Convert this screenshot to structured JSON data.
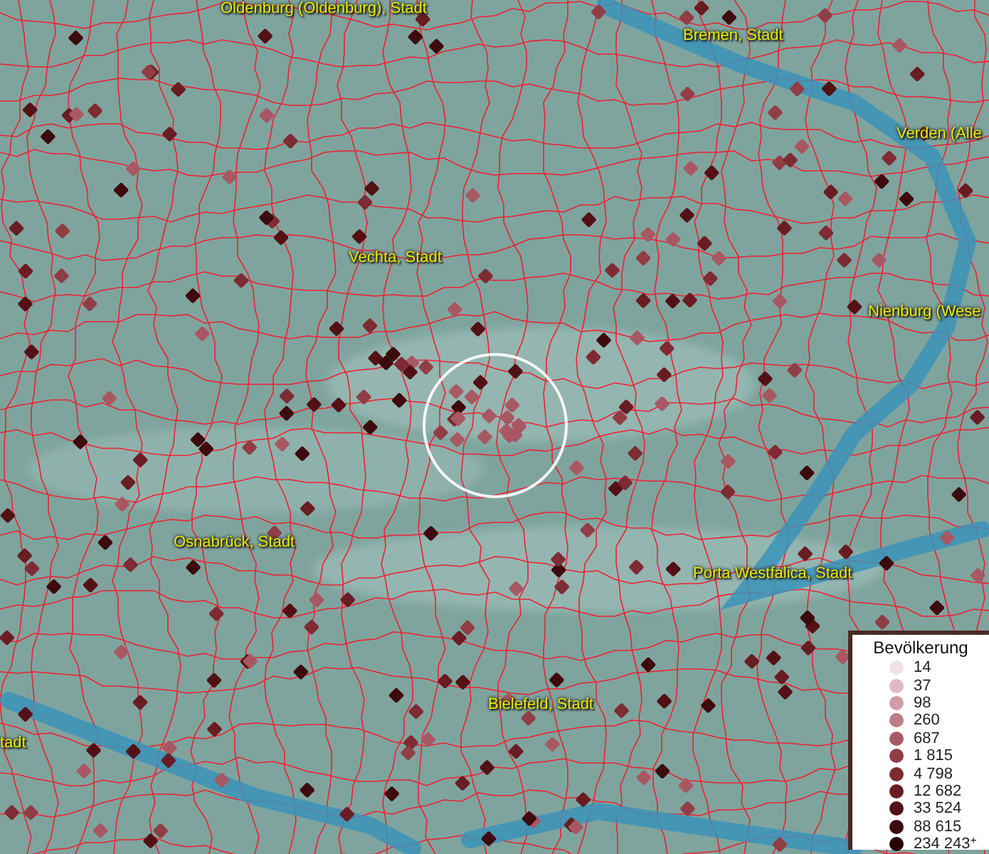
{
  "map": {
    "places": [
      {
        "name": "Oldenburg (Oldenburg), Stadt"
      },
      {
        "name": "Bremen, Stadt"
      },
      {
        "name": "Verden (Alle"
      },
      {
        "name": "Vechta, Stadt"
      },
      {
        "name": "Nienburg (Wese"
      },
      {
        "name": "Osnabrück, Stadt"
      },
      {
        "name": "Porta Westfalica, Stadt"
      },
      {
        "name": "Bielefeld, Stadt"
      },
      {
        "name": "tadt"
      }
    ]
  },
  "legend": {
    "title": "Bevölkerung",
    "items": [
      {
        "label": "14",
        "color": "#f5e1ea"
      },
      {
        "label": "37",
        "color": "#e2b8c2"
      },
      {
        "label": "98",
        "color": "#d09ca5"
      },
      {
        "label": "260",
        "color": "#bd7c86"
      },
      {
        "label": "687",
        "color": "#a85862"
      },
      {
        "label": "1 815",
        "color": "#913d46"
      },
      {
        "label": "4 798",
        "color": "#7e2b33"
      },
      {
        "label": "12 682",
        "color": "#691c22"
      },
      {
        "label": "33 524",
        "color": "#531116"
      },
      {
        "label": "88 615",
        "color": "#3d0a0d"
      },
      {
        "label": "234 243$^{+}$",
        "color": "#290507"
      }
    ]
  }
}
